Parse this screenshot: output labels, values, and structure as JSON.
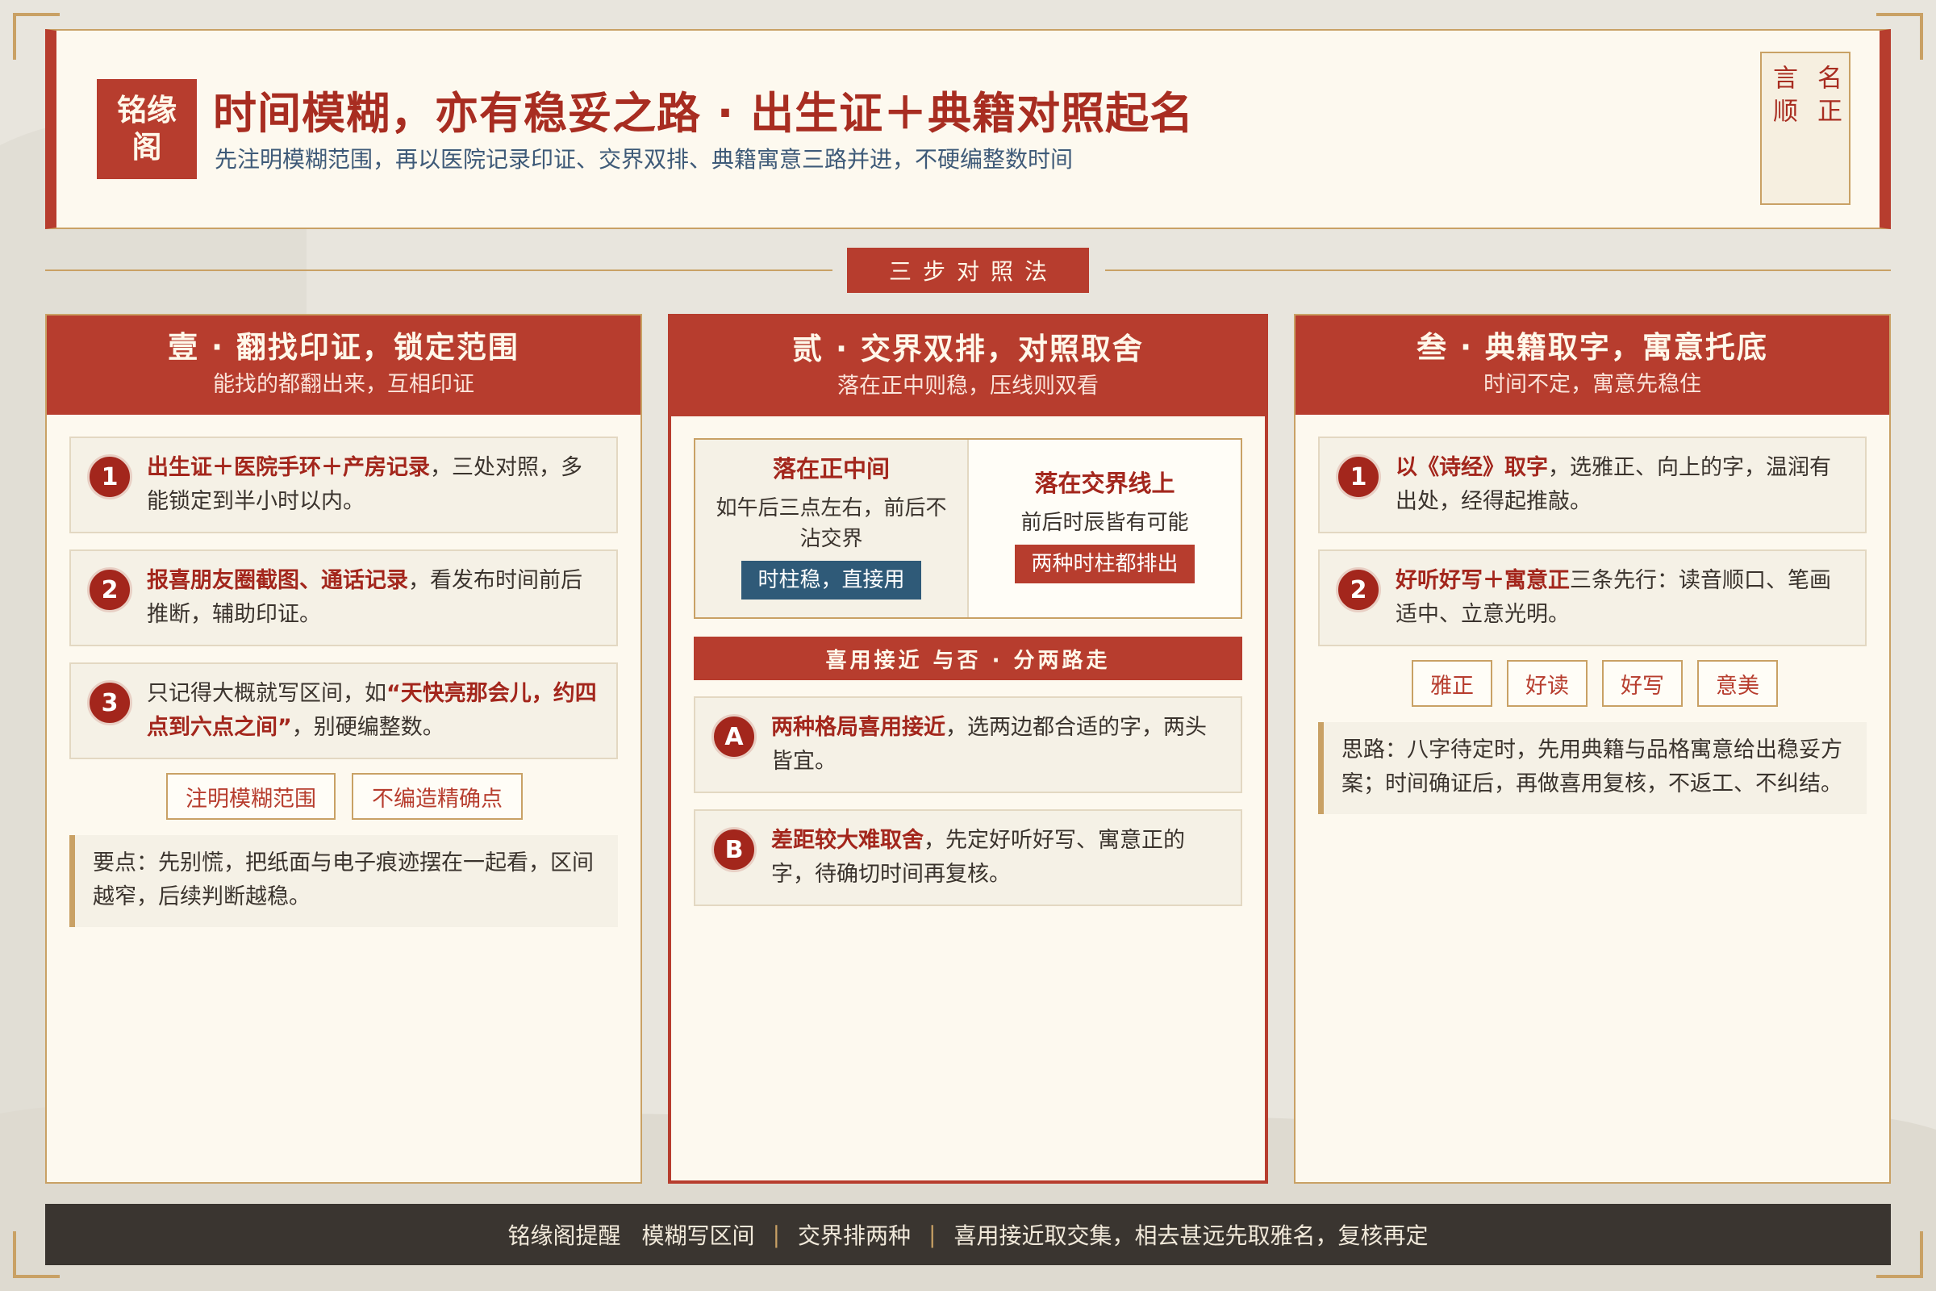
{
  "header": {
    "logo": [
      "铭缘",
      "阁"
    ],
    "title": "时间模糊，亦有稳妥之路 · 出生证＋典籍对照起名",
    "subtitle": "先注明模糊范围，再以医院记录印证、交界双排、典籍寓意三路并进，不硬编整数时间",
    "seal": [
      "名正",
      "言顺"
    ]
  },
  "divider": {
    "label": "三步对照法"
  },
  "col1": {
    "title": "壹 · 翻找印证，锁定范围",
    "sub": "能找的都翻出来，互相印证",
    "items": [
      {
        "num": "1",
        "bold": "出生证＋医院手环＋产房记录",
        "text": "，三处对照，多能锁定到半小时以内。",
        "bold_after": "",
        "text_after": ""
      },
      {
        "num": "2",
        "bold": "报喜朋友圈截图、通话记录",
        "text": "，看发布时间前后推断，辅助印证。",
        "bold_after": "",
        "text_after": ""
      },
      {
        "num": "3",
        "bold": "",
        "text": "只记得大概就写区间，如",
        "bold_after": "“天快亮那会儿，约四点到六点之间”",
        "text_after": "，别硬编整数。"
      }
    ],
    "tags": [
      "注明模糊范围",
      "不编造精确点"
    ],
    "note": "要点：先别慌，把纸面与电子痕迹摆在一起看，区间越窄，后续判断越稳。"
  },
  "col2": {
    "title": "贰 · 交界双排，对照取舍",
    "sub": "落在正中则稳，压线则双看",
    "left": {
      "title": "落在正中间",
      "desc": "如午后三点左右，前后不沾交界",
      "chip": "时柱稳，直接用"
    },
    "right": {
      "title": "落在交界线上",
      "desc": "前后时辰皆有可能",
      "chip": "两种时柱都排出"
    },
    "bar": "喜用接近 与否 · 分两路走",
    "items": [
      {
        "num": "A",
        "bold": "两种格局喜用接近",
        "text": "，选两边都合适的字，两头皆宜。"
      },
      {
        "num": "B",
        "bold": "差距较大难取舍",
        "text": "，先定好听好写、寓意正的字，待确切时间再复核。"
      }
    ]
  },
  "col3": {
    "title": "叁 · 典籍取字，寓意托底",
    "sub": "时间不定，寓意先稳住",
    "items": [
      {
        "num": "1",
        "bold": "以《诗经》取字",
        "text": "，选雅正、向上的字，温润有出处，经得起推敲。"
      },
      {
        "num": "2",
        "bold": "好听好写＋寓意正",
        "text": "三条先行：读音顺口、笔画适中、立意光明。"
      }
    ],
    "tags": [
      "雅正",
      "好读",
      "好写",
      "意美"
    ],
    "note": "思路：八字待定时，先用典籍与品格寓意给出稳妥方案；时间确证后，再做喜用复核，不返工、不纠结。"
  },
  "footer": {
    "lead": "铭缘阁提醒",
    "parts": [
      "模糊写区间",
      "交界排两种",
      "喜用接近取交集，相去甚远先取雅名，复核再定"
    ]
  },
  "colors": {
    "accent": "#b73d2e",
    "gold": "#c9a165",
    "blue": "#2f5a78",
    "dark": "#3a3530"
  }
}
